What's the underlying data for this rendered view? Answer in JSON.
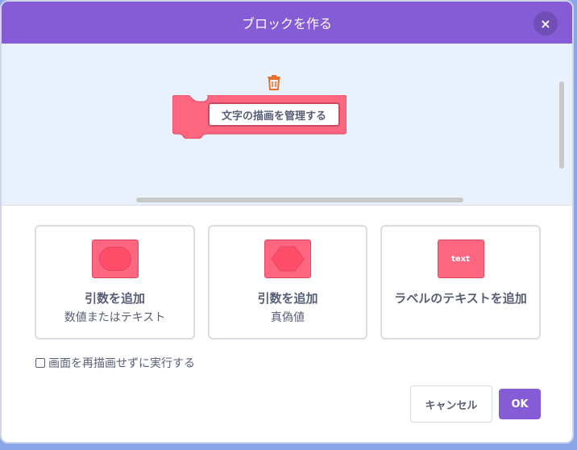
{
  "dialog": {
    "title": "ブロックを作る",
    "close_icon": "×"
  },
  "workspace": {
    "block_label": "文字の描画を管理する",
    "block_color": "#ff6680"
  },
  "options": [
    {
      "title": "引数を追加",
      "subtitle": "数値またはテキスト",
      "icon": "reporter-shape-icon"
    },
    {
      "title": "引数を追加",
      "subtitle": "真偽値",
      "icon": "boolean-shape-icon"
    },
    {
      "title": "ラベルのテキストを追加",
      "icon_text": "text",
      "icon": "label-text-icon"
    }
  ],
  "checkbox": {
    "label": "画面を再描画せずに実行する",
    "checked": false
  },
  "buttons": {
    "cancel": "キャンセル",
    "ok": "OK"
  },
  "colors": {
    "header": "#855cd6",
    "accent_block": "#ff6680",
    "workspace_bg": "#e9f1fc"
  }
}
